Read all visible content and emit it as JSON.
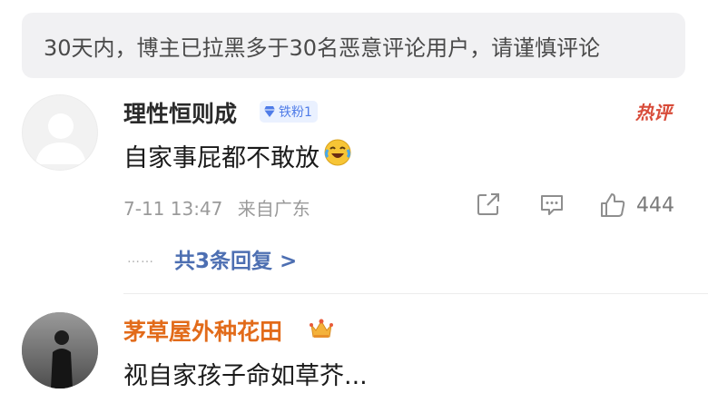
{
  "notice": {
    "text": "30天内，博主已拉黑多于30名恶意评论用户，请谨慎评论"
  },
  "comments": [
    {
      "username": "理性恒则成",
      "badge": "铁粉1",
      "hot_label": "热评",
      "content": "自家事屁都不敢放",
      "emoji": "laugh-cry-emoji",
      "time": "7-11 13:47",
      "location": "来自广东",
      "like_count": "444",
      "replies_label": "共3条回复 >",
      "reply_dots": "……"
    },
    {
      "username": "茅草屋外种花田",
      "badge_icon": "crown-icon",
      "content": "视自家孩子命如草芥..."
    }
  ],
  "colors": {
    "notice_bg": "#f1f1f3",
    "username_vip": "#e26b1a",
    "badge_blue": "#4f7ce8",
    "hot_red": "#d84c3a",
    "reply_link": "#4d6fb2",
    "meta_gray": "#9a9a9a"
  }
}
